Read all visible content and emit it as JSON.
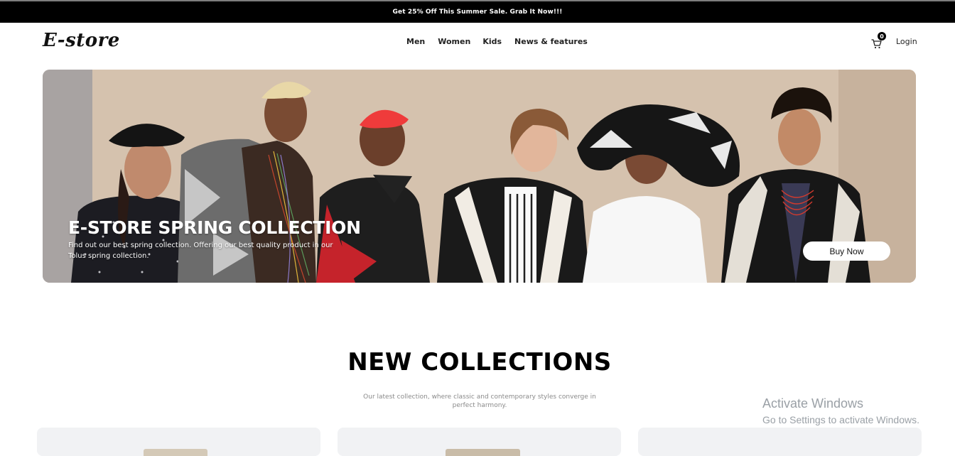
{
  "promo": {
    "text": "Get 25% Off This Summer Sale. Grab It Now!!!"
  },
  "nav": {
    "logo": "E-store",
    "menu": [
      "Men",
      "Women",
      "Kids",
      "News & features"
    ],
    "cart_count": "0",
    "login_label": "Login",
    "icons": {
      "cart": "shopping-cart-icon"
    }
  },
  "hero": {
    "title": "E-STORE SPRING COLLECTION",
    "subtitle": "Find out our best spring collection. Offering our best quality product in our Tolus spring collection.",
    "button_label": "Buy Now"
  },
  "collections": {
    "title": "NEW COLLECTIONS",
    "subtitle": "Our latest collection, where classic and contemporary styles converge in perfect harmony."
  },
  "os_watermark": {
    "title": "Activate Windows",
    "subtitle": "Go to Settings to activate Windows."
  }
}
